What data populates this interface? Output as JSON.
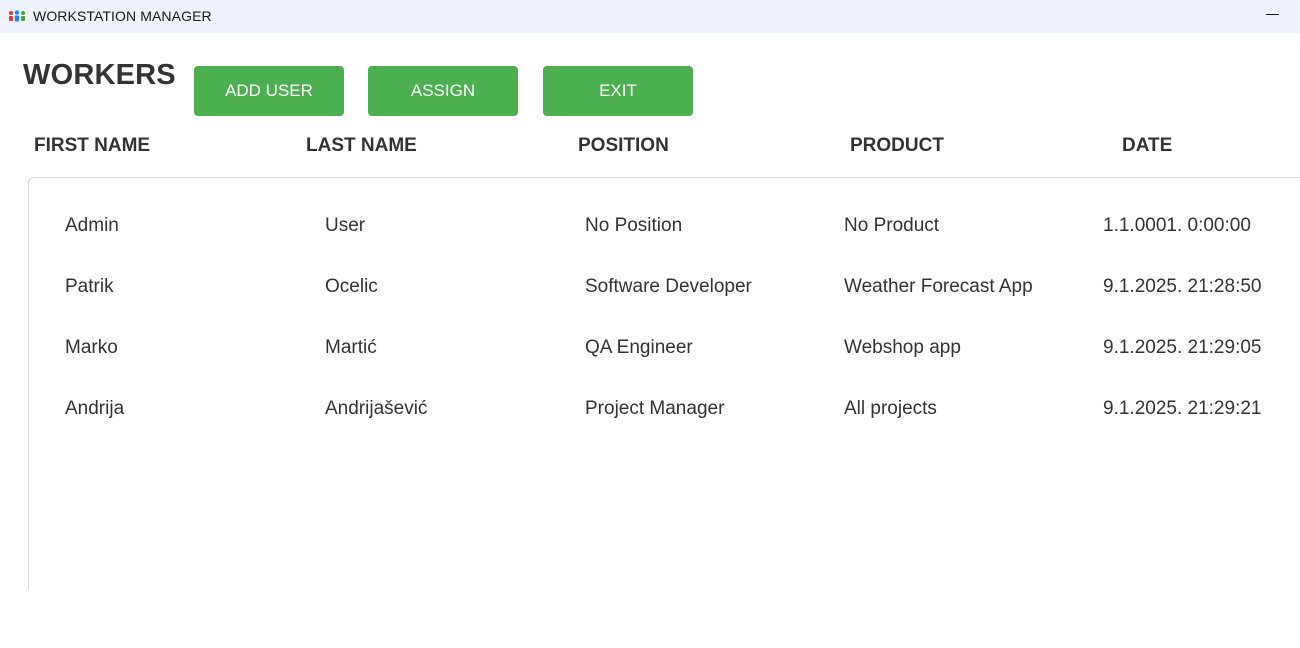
{
  "window": {
    "title": "WORKSTATION MANAGER"
  },
  "header": {
    "title": "WORKERS",
    "buttons": {
      "add_user": "ADD USER",
      "assign": "ASSIGN",
      "exit": "EXIT"
    }
  },
  "table": {
    "columns": [
      "FIRST NAME",
      "LAST NAME",
      "POSITION",
      "PRODUCT",
      "DATE"
    ],
    "rows": [
      [
        "Admin",
        "User",
        "No Position",
        "No Product",
        "1.1.0001. 0:00:00"
      ],
      [
        "Patrik",
        "Ocelic",
        "Software Developer",
        "Weather Forecast App",
        "9.1.2025. 21:28:50"
      ],
      [
        "Marko",
        "Martić",
        "QA Engineer",
        "Webshop app",
        "9.1.2025. 21:29:05"
      ],
      [
        "Andrija",
        "Andrijašević",
        "Project Manager",
        "All projects",
        "9.1.2025. 21:29:21"
      ]
    ]
  },
  "colors": {
    "button_bg": "#4caf50",
    "titlebar_bg": "#eef2f9",
    "text": "#333333"
  },
  "icons": {
    "app": "people-group-icon",
    "minimize": "minimize-icon"
  }
}
